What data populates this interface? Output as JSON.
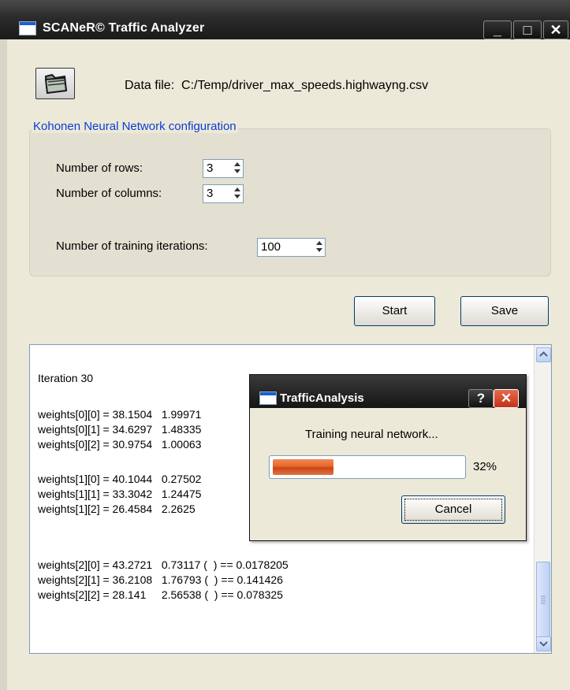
{
  "window": {
    "title": "SCANeR© Traffic Analyzer",
    "controls": {
      "minimize": "_",
      "maximize": "□",
      "close": "✕"
    }
  },
  "data_file": {
    "label": "Data file:",
    "path": "C:/Temp/driver_max_speeds.highwayng.csv",
    "icon": "folder-icon"
  },
  "config": {
    "title": "Kohonen Neural Network configuration",
    "rows_label": "Number of rows:",
    "rows_value": "3",
    "cols_label": "Number of columns:",
    "cols_value": "3",
    "iterations_label": "Number of training iterations:",
    "iterations_value": "100"
  },
  "buttons": {
    "start": "Start",
    "save": "Save"
  },
  "log": {
    "heading": "Iteration 30",
    "lines": [
      "weights[0][0] = 38.1504   1.99971",
      "weights[0][1] = 34.6297   1.48335",
      "weights[0][2] = 30.9754   1.00063",
      "weights[1][0] = 40.1044   0.27502",
      "weights[1][1] = 33.3042   1.24475",
      "weights[1][2] = 26.4584   2.2625",
      "weights[2][0] = 43.2721   0.73117 (  ) == 0.0178205",
      "weights[2][1] = 36.2108   1.76793 (  ) == 0.141426",
      "weights[2][2] = 28.141     2.56538 (  ) == 0.078325"
    ]
  },
  "dialog": {
    "title": "TrafficAnalysis",
    "help": "?",
    "close": "✕",
    "message": "Training neural network...",
    "progress": 32,
    "progress_text": "32%",
    "cancel": "Cancel"
  },
  "colors": {
    "progress": "#e8662c",
    "group_title": "#0b3bd6"
  }
}
